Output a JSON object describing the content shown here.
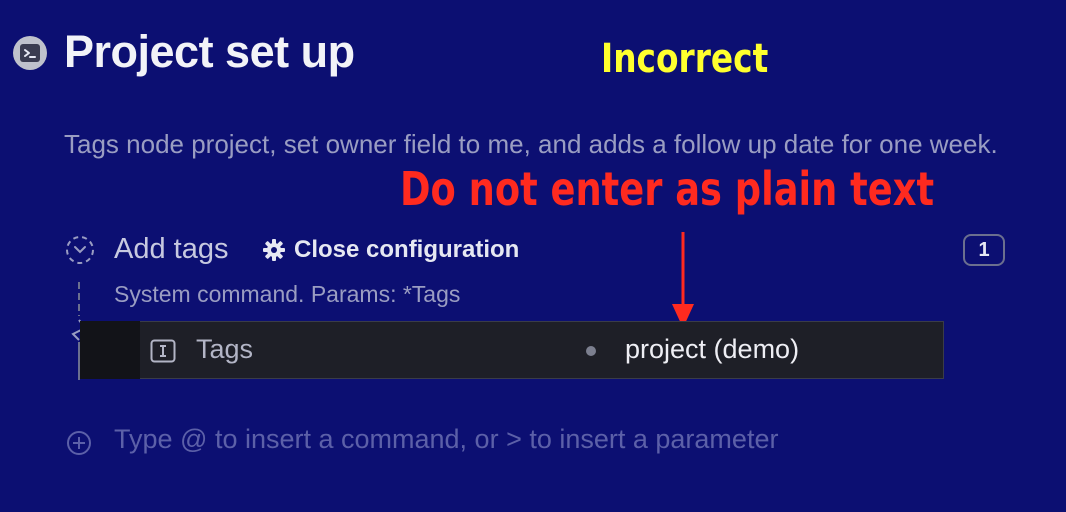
{
  "page": {
    "title": "Project set up",
    "title_icon": "terminal-icon",
    "description": "Tags node project, set owner field to me, and adds a follow up date for one week."
  },
  "annotations": {
    "incorrect": "Incorrect",
    "plain_text_warning": "Do not enter as plain text"
  },
  "command": {
    "name": "Add tags",
    "icon": "dashed-circle-icon",
    "config_button": "Close configuration",
    "config_icon": "gear-icon",
    "badge_count": "1",
    "subtitle": "System command. Params: *Tags"
  },
  "param": {
    "icon": "text-field-icon",
    "label": "Tags",
    "value": "project (demo)"
  },
  "add_command": {
    "icon": "plus-circle-icon",
    "placeholder": "Type @ to insert a command, or > to insert a parameter"
  },
  "colors": {
    "background": "#0c0f72",
    "annotation_yellow": "#ffff2e",
    "annotation_red": "#ff2a1f",
    "param_row": "#1e1f27"
  }
}
